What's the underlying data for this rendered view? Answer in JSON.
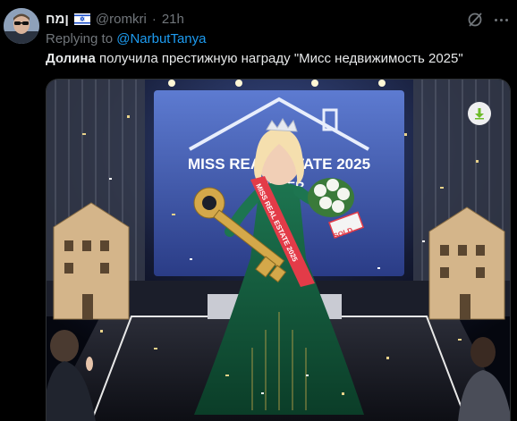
{
  "tweet": {
    "display_name": "ןמח",
    "flag_icon": "israel-flag-icon",
    "handle": "@romkri",
    "separator": "·",
    "time": "21h",
    "reply_prefix": "Replying to",
    "reply_to": "@NarbutTanya",
    "text_bold": "Долина",
    "text_rest": " получила престижную награду \"Мисс недвижимость 2025\""
  },
  "media": {
    "backdrop_sign_line1": "MISS REAL ESTATE 2025",
    "backdrop_sign_line2": "WINNER",
    "sash_text": "MISS REAL ESTATE 2025",
    "tag_text": "SOLD",
    "download_icon": "download-arrow-icon"
  },
  "icons": {
    "grok": "grok-icon",
    "more": "more-icon"
  },
  "colors": {
    "background": "#000000",
    "text": "#e7e9ea",
    "muted": "#71767b",
    "link": "#1d9bf0",
    "gown": "#0f5a3c",
    "gold": "#d4a84a",
    "download_icon": "#6dbb2a"
  }
}
